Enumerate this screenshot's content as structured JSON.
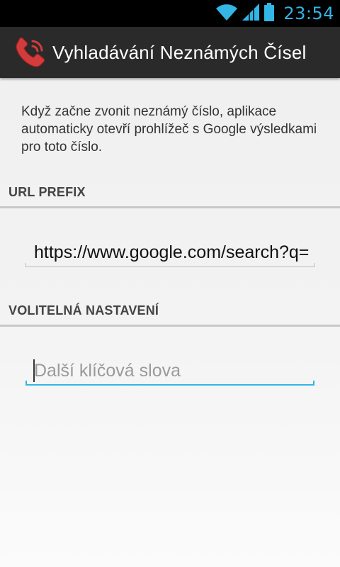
{
  "status_bar": {
    "time": "23:54",
    "wifi_icon": "wifi-icon",
    "signal_icon": "signal-icon",
    "battery_icon": "battery-icon",
    "accent_color": "#33b5e5"
  },
  "action_bar": {
    "title": "Vyhladávání Neznámých Čísel",
    "app_icon": "phone-ringing-icon",
    "icon_color": "#cc3333"
  },
  "description": "Když začne zvonit neznámý číslo, aplikace automaticky otevří prohlížeč s Google výsledkami pro toto číslo.",
  "sections": {
    "url_prefix": {
      "header": "URL PREFIX",
      "value": "https://www.google.com/search?q="
    },
    "optional": {
      "header": "VOLITELNÁ NASTAVENÍ",
      "placeholder": "Další klíčová slova",
      "value": ""
    }
  },
  "colors": {
    "focus": "#33b5e5",
    "action_bar": "#2a2a2a"
  }
}
